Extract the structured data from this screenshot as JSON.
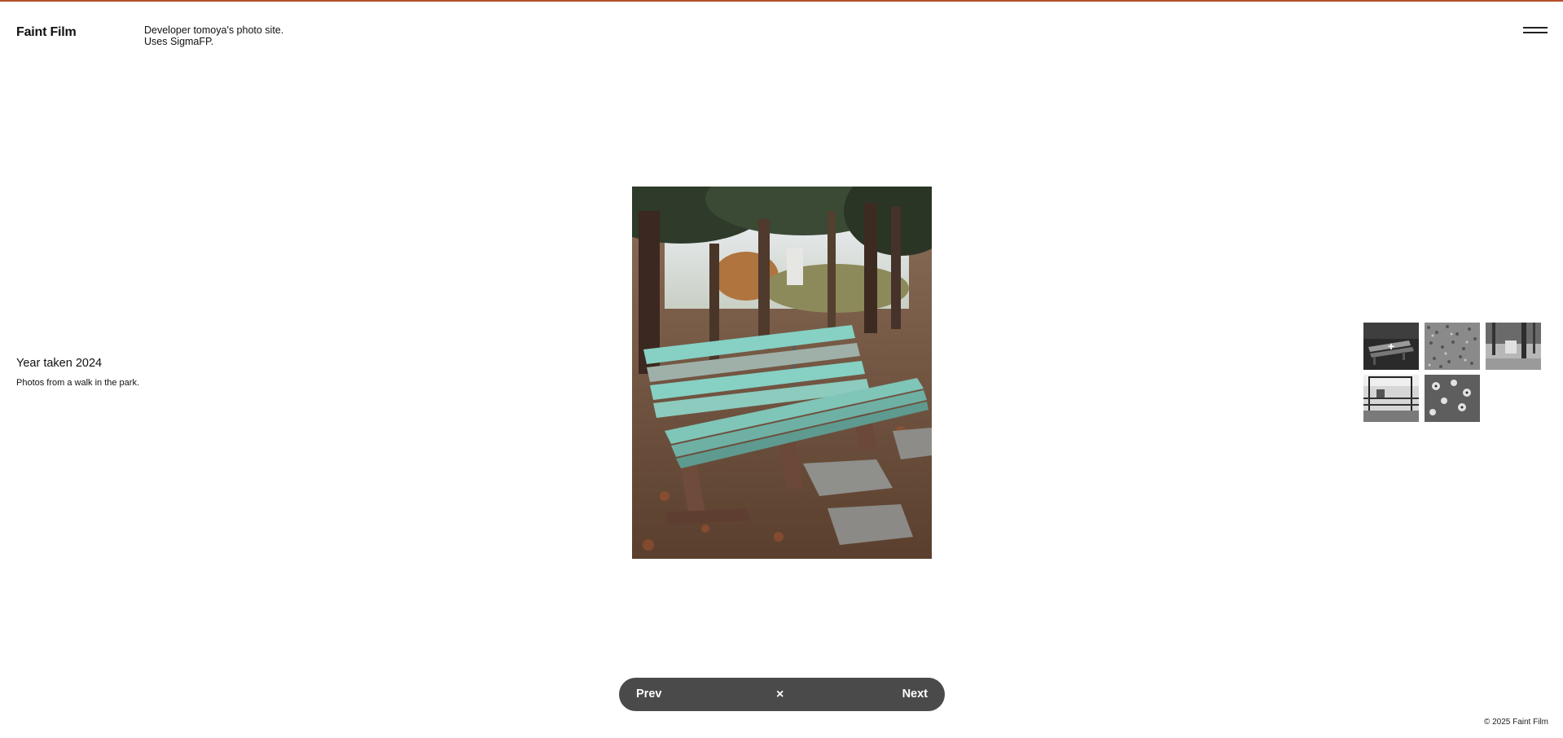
{
  "header": {
    "site_title": "Faint Film",
    "tagline_line1": "Developer tomoya's photo site.",
    "tagline_line2": "Uses SigmaFP.",
    "menu_icon": "hamburger-icon"
  },
  "photo_info": {
    "year": "Year taken 2024",
    "description": "Photos from a walk in the park."
  },
  "thumbnails": {
    "items": [
      {
        "subject": "bench",
        "style": "monochrome",
        "active": true
      },
      {
        "subject": "gravel",
        "style": "monochrome",
        "active": false
      },
      {
        "subject": "trees",
        "style": "monochrome",
        "active": false
      },
      {
        "subject": "railing",
        "style": "monochrome",
        "active": false
      },
      {
        "subject": "flowers",
        "style": "monochrome",
        "active": false
      }
    ],
    "active_overlay_icon": "plus-icon",
    "active_overlay_text": "+"
  },
  "nav": {
    "prev_label": "Prev",
    "close_label": "×",
    "next_label": "Next"
  },
  "footer": {
    "copyright": "© 2025 Faint Film"
  },
  "colors": {
    "accent_line": "#b5502a",
    "nav_bg": "#4a4a4a",
    "bench": "#86d1c4"
  }
}
